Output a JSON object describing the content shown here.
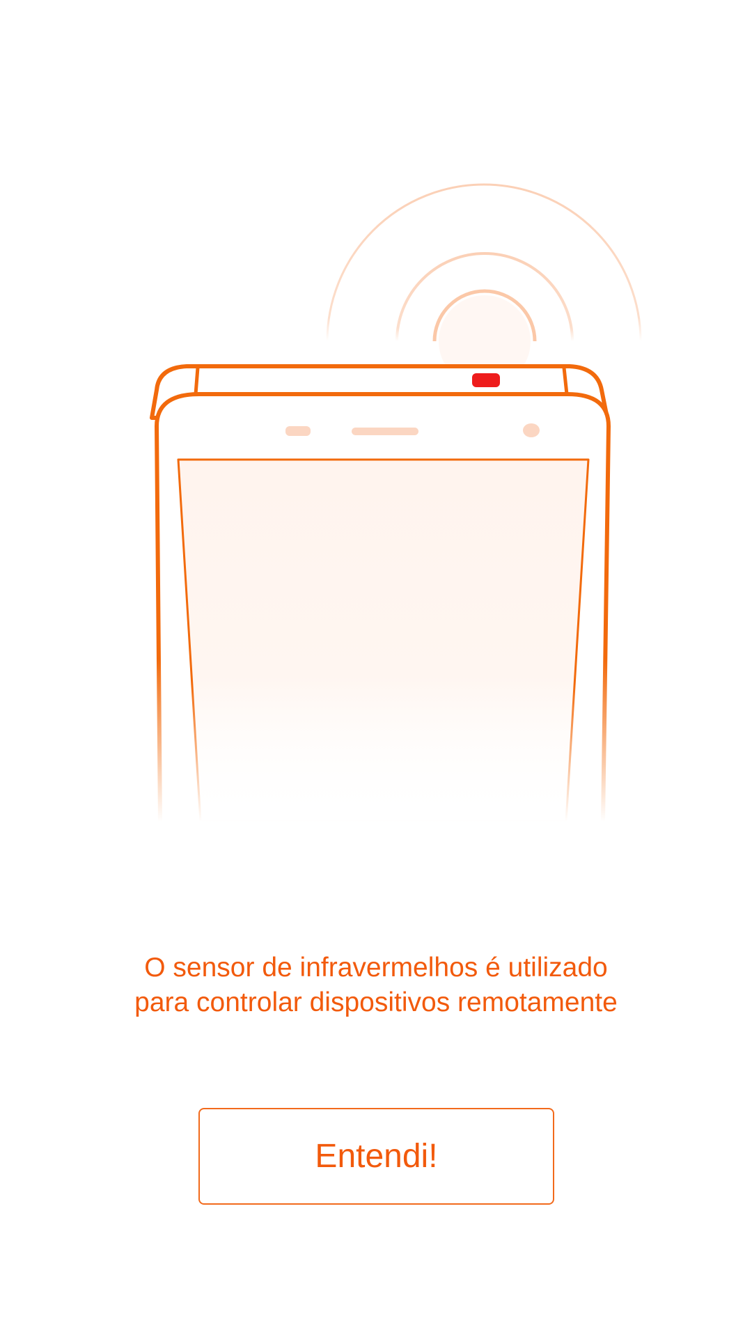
{
  "colors": {
    "accent": "#f25a0c",
    "phone_outline": "#f26a0c",
    "ir_sensor": "#ee1c1c",
    "screen_tint": "#fff5f0",
    "waves": "#fbd4bd"
  },
  "illustration": {
    "icon": "phone-ir-blaster-icon"
  },
  "message": {
    "line1": "O sensor de infravermelhos é utilizado",
    "line2": "para controlar dispositivos remotamente"
  },
  "button": {
    "label": "Entendi!"
  }
}
